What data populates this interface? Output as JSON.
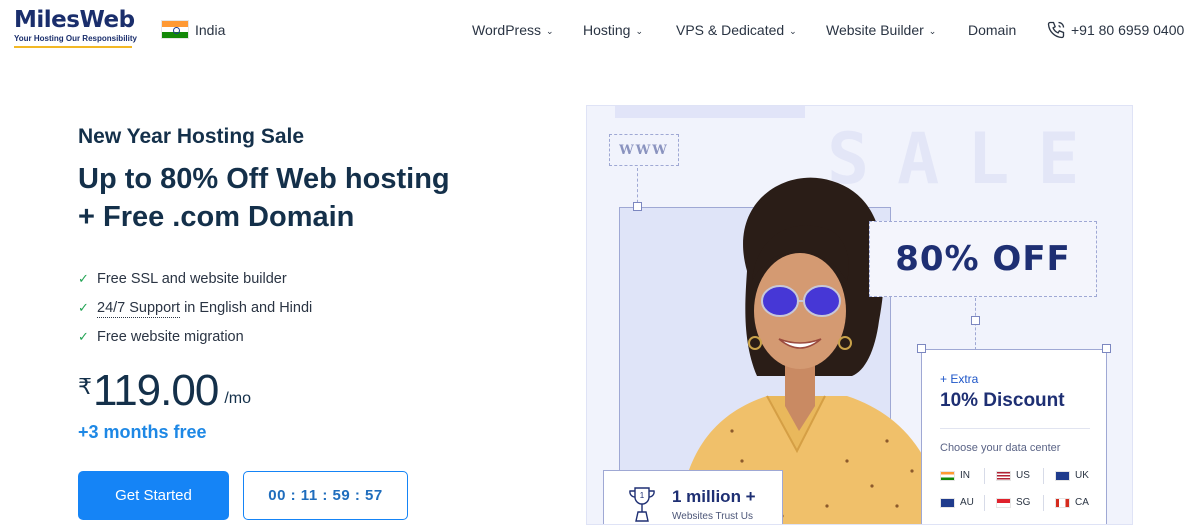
{
  "header": {
    "logo_name": "MilesWeb",
    "logo_tagline": "Your Hosting Our Responsibility",
    "country": "India",
    "nav": [
      {
        "label": "WordPress",
        "has_dropdown": true
      },
      {
        "label": "Hosting",
        "has_dropdown": true
      },
      {
        "label": "VPS & Dedicated",
        "has_dropdown": true
      },
      {
        "label": "Website Builder",
        "has_dropdown": true
      },
      {
        "label": "Domain",
        "has_dropdown": false
      }
    ],
    "phone": "+91 80 6959 0400"
  },
  "hero": {
    "sale_title": "New Year Hosting Sale",
    "headline_line1": "Up to 80% Off Web hosting",
    "headline_line2": "+ Free .com Domain",
    "features": [
      {
        "text": "Free SSL and website builder"
      },
      {
        "link": "24/7 Support",
        "text": " in English and Hindi"
      },
      {
        "text": "Free website migration"
      }
    ],
    "currency": "₹",
    "price": "119.00",
    "per": "/mo",
    "bonus": "+3 months free",
    "cta": "Get Started",
    "timer": "00 : 11 : 59 : 57"
  },
  "promo": {
    "www": "WWW",
    "sale_word": "SALE",
    "off": "80% OFF",
    "extra": "+ Extra",
    "discount": "10% Discount",
    "choose": "Choose your data center",
    "datacenters": [
      "IN",
      "US",
      "UK",
      "AU",
      "SG",
      "CA"
    ],
    "trust_count": "1 million +",
    "trust_sub": "Websites Trust Us"
  },
  "colors": {
    "brand_navy": "#1a2e6c",
    "accent_blue": "#1584f6",
    "check_green": "#23a455",
    "logo_underline": "#f2b825"
  }
}
